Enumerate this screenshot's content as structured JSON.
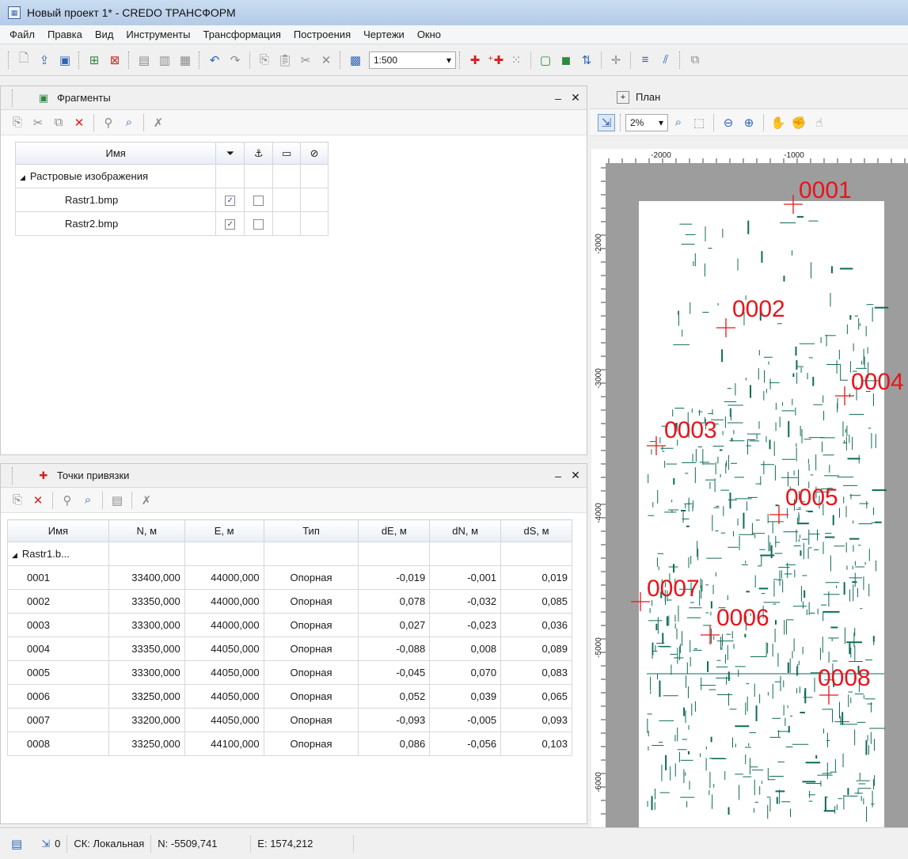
{
  "window": {
    "title": "Новый проект 1* - CREDO ТРАНСФОРМ"
  },
  "menu": [
    "Файл",
    "Правка",
    "Вид",
    "Инструменты",
    "Трансформация",
    "Построения",
    "Чертежи",
    "Окно"
  ],
  "toolbar": {
    "scale": "1:500"
  },
  "fragments": {
    "title": "Фрагменты",
    "columns": {
      "name": "Имя"
    },
    "group": "Растровые изображения",
    "rows": [
      {
        "name": "Rastr1.bmp",
        "visible": true,
        "anchored": false
      },
      {
        "name": "Rastr2.bmp",
        "visible": true,
        "anchored": false
      }
    ]
  },
  "points": {
    "title": "Точки привязки",
    "columns": [
      "Имя",
      "N, м",
      "E, м",
      "Тип",
      "dE, м",
      "dN, м",
      "dS, м"
    ],
    "group": "Rastr1.b...",
    "rows": [
      {
        "name": "0001",
        "n": "33400,000",
        "e": "44000,000",
        "type": "Опорная",
        "de": "-0,019",
        "dn": "-0,001",
        "ds": "0,019"
      },
      {
        "name": "0002",
        "n": "33350,000",
        "e": "44000,000",
        "type": "Опорная",
        "de": "0,078",
        "dn": "-0,032",
        "ds": "0,085"
      },
      {
        "name": "0003",
        "n": "33300,000",
        "e": "44000,000",
        "type": "Опорная",
        "de": "0,027",
        "dn": "-0,023",
        "ds": "0,036"
      },
      {
        "name": "0004",
        "n": "33350,000",
        "e": "44050,000",
        "type": "Опорная",
        "de": "-0,088",
        "dn": "0,008",
        "ds": "0,089"
      },
      {
        "name": "0005",
        "n": "33300,000",
        "e": "44050,000",
        "type": "Опорная",
        "de": "-0,045",
        "dn": "0,070",
        "ds": "0,083"
      },
      {
        "name": "0006",
        "n": "33250,000",
        "e": "44050,000",
        "type": "Опорная",
        "de": "0,052",
        "dn": "0,039",
        "ds": "0,065"
      },
      {
        "name": "0007",
        "n": "33200,000",
        "e": "44050,000",
        "type": "Опорная",
        "de": "-0,093",
        "dn": "-0,005",
        "ds": "0,093"
      },
      {
        "name": "0008",
        "n": "33250,000",
        "e": "44100,000",
        "type": "Опорная",
        "de": "0,086",
        "dn": "-0,056",
        "ds": "0,103"
      }
    ]
  },
  "plan": {
    "title": "План",
    "zoom": "2%",
    "hticks": [
      "-2000",
      "-1000"
    ],
    "vticks": [
      "-2000",
      "-3000",
      "-4000",
      "-5000",
      "-6000"
    ],
    "markers": [
      "0001",
      "0002",
      "0003",
      "0004",
      "0005",
      "0006",
      "0007",
      "0008"
    ]
  },
  "status": {
    "sel_count": "0",
    "cs": "СК: Локальная",
    "n": "N: -5509,741",
    "e": "E: 1574,212"
  },
  "colors": {
    "marker": "#e8141c",
    "raster": "#0d6b55",
    "canvas_bg": "#9d9d9d"
  }
}
